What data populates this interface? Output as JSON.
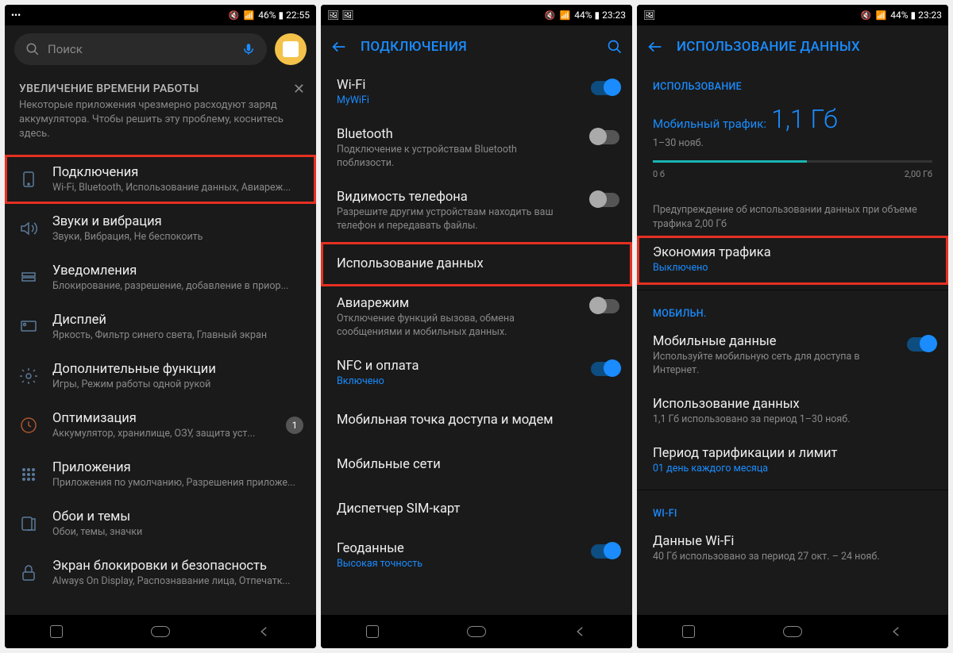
{
  "screen1": {
    "statusbar": {
      "left_icons": "•••",
      "right": "46% ▮ 22:55",
      "net_icons": "📶 ⚡",
      "mute": "🔇"
    },
    "search_placeholder": "Поиск",
    "tip": {
      "title": "УВЕЛИЧЕНИЕ ВРЕМЕНИ РАБОТЫ",
      "body": "Некоторые приложения чрезмерно расходуют заряд аккумулятора. Чтобы решить эту проблему, коснитесь здесь."
    },
    "items": [
      {
        "title": "Подключения",
        "sub": "Wi-Fi, Bluetooth, Использование данных, Авиареж...",
        "icon": "connections",
        "highlight": true
      },
      {
        "title": "Звуки и вибрация",
        "sub": "Звуки, Вибрация, Не беспокоить",
        "icon": "sound"
      },
      {
        "title": "Уведомления",
        "sub": "Блокирование, разрешение, добавление в приор...",
        "icon": "notif"
      },
      {
        "title": "Дисплей",
        "sub": "Яркость, Фильтр синего света, Главный экран",
        "icon": "display"
      },
      {
        "title": "Дополнительные функции",
        "sub": "Игры, Режим работы одной рукой",
        "icon": "advanced"
      },
      {
        "title": "Оптимизация",
        "sub": "Аккумулятор, хранилище, ОЗУ, защита уст...",
        "icon": "optimize",
        "badge": "1"
      },
      {
        "title": "Приложения",
        "sub": "Приложения по умолчанию, Разрешения приложе...",
        "icon": "apps"
      },
      {
        "title": "Обои и темы",
        "sub": "Обои, темы, значки",
        "icon": "wallpaper"
      },
      {
        "title": "Экран блокировки и безопасность",
        "sub": "Always On Display, Распознавание лица, Отпечатк...",
        "icon": "lock"
      }
    ]
  },
  "screen2": {
    "statusbar": {
      "left_icons": "🖼 🖼",
      "right": "44% ▮ 23:23"
    },
    "header_title": "ПОДКЛЮЧЕНИЯ",
    "items": [
      {
        "title": "Wi-Fi",
        "sub": "MyWiFi",
        "sub_blue": true,
        "toggle": "on"
      },
      {
        "title": "Bluetooth",
        "sub": "Подключение к устройствам Bluetooth поблизости.",
        "toggle": "off"
      },
      {
        "title": "Видимость телефона",
        "sub": "Разрешите другим устройствам находить ваш телефон и передавать файлы.",
        "toggle": "off"
      },
      {
        "title": "Использование данных",
        "sub": "",
        "highlight": true
      },
      {
        "title": "Авиарежим",
        "sub": "Отключение функций вызова, обмена сообщениями и мобильных данных.",
        "toggle": "off"
      },
      {
        "title": "NFC и оплата",
        "sub": "Включено",
        "sub_blue": true,
        "toggle": "on"
      },
      {
        "title": "Мобильная точка доступа и модем",
        "sub": ""
      },
      {
        "title": "Мобильные сети",
        "sub": ""
      },
      {
        "title": "Диспетчер SIM-карт",
        "sub": ""
      },
      {
        "title": "Геоданные",
        "sub": "Высокая точность",
        "sub_blue": true,
        "toggle": "on"
      }
    ]
  },
  "screen3": {
    "statusbar": {
      "left_icons": "🖼",
      "right": "44% ▮ 23:23"
    },
    "header_title": "ИСПОЛЬЗОВАНИЕ ДАННЫХ",
    "section1_header": "ИСПОЛЬЗОВАНИЕ",
    "usage_label": "Мобильный трафик:",
    "usage_value": "1,1 Гб",
    "usage_period": "1–30 нояб.",
    "scale_min": "0 б",
    "scale_max": "2,00 Гб",
    "usage_warn": "Предупреждение об использовании данных при объеме трафика 2,00 Гб",
    "saver_title": "Экономия трафика",
    "saver_sub": "Выключено",
    "section2_header": "МОБИЛЬН.",
    "mobile_items": [
      {
        "title": "Мобильные данные",
        "sub": "Используйте мобильную сеть для доступа в Интернет.",
        "toggle": "on"
      },
      {
        "title": "Использование данных",
        "sub": "1,1 Гб использовано за период 1–30 нояб."
      },
      {
        "title": "Период тарификации и лимит",
        "sub": "01 день каждого месяца",
        "sub_blue": true
      }
    ],
    "section3_header": "WI-FI",
    "wifi_items": [
      {
        "title": "Данные Wi-Fi",
        "sub": "40 Гб использовано за период 27 окт. – 24 нояб."
      }
    ]
  }
}
